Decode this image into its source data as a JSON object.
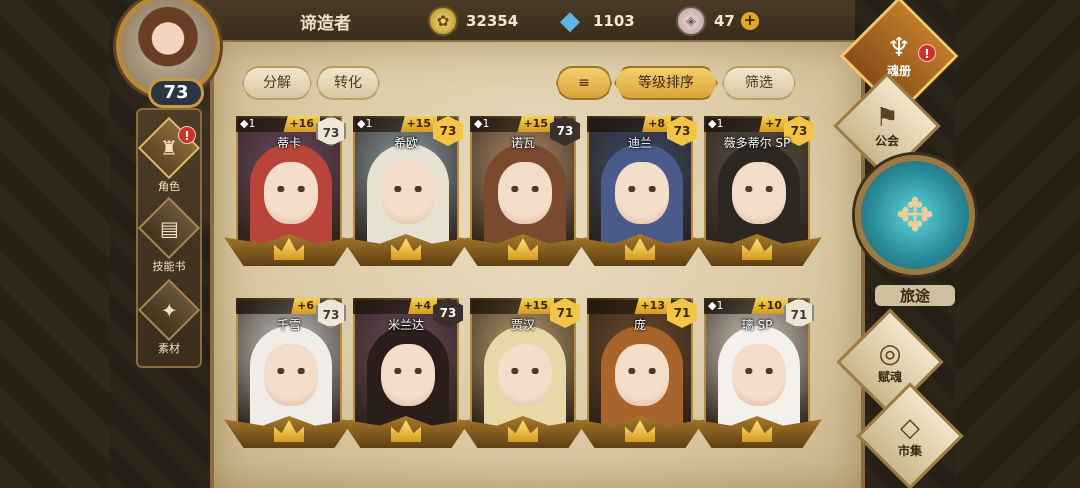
{
  "header": {
    "username": "谛造者",
    "gold": "32354",
    "crystals": "1103",
    "gems": "47",
    "plus_label": "+"
  },
  "player": {
    "level": "73"
  },
  "left_nav": [
    {
      "label": "角色",
      "icon": "helmet-icon",
      "glyph": "♜",
      "active": true,
      "alert": "!"
    },
    {
      "label": "技能书",
      "icon": "skillbook-icon",
      "glyph": "▤",
      "active": false
    },
    {
      "label": "素材",
      "icon": "material-icon",
      "glyph": "✦",
      "active": false
    }
  ],
  "toolbar": {
    "decompose": "分解",
    "convert": "转化",
    "sort_icon": "≡",
    "sort_by_level": "等级排序",
    "filter": "筛选"
  },
  "cards": [
    {
      "name": "蒂卡",
      "star": "◆1",
      "plus": "+16",
      "level": "73",
      "lvl_style": "light",
      "hair": "#b8443a",
      "bg": "#6b4a5e"
    },
    {
      "name": "希欧",
      "star": "◆1",
      "plus": "+15",
      "level": "73",
      "lvl_style": "gold",
      "hair": "#e8e0d0",
      "bg": "#8a9aa0"
    },
    {
      "name": "诺瓦",
      "star": "◆1",
      "plus": "+15",
      "level": "73",
      "lvl_style": "dark",
      "hair": "#7a4a2e",
      "bg": "#b08a6a"
    },
    {
      "name": "迪兰",
      "star": "",
      "plus": "+8",
      "level": "73",
      "lvl_style": "gold",
      "hair": "#4a5a8a",
      "bg": "#3c4a6a"
    },
    {
      "name": "薇多蒂尔 SP",
      "star": "◆1",
      "plus": "+7",
      "level": "73",
      "lvl_style": "gold",
      "hair": "#2e2620",
      "bg": "#5a5046"
    },
    {
      "name": "千雪",
      "star": "",
      "plus": "+6",
      "level": "73",
      "lvl_style": "light",
      "hair": "#f0ece8",
      "bg": "#c8c4c0"
    },
    {
      "name": "米兰达",
      "star": "",
      "plus": "+4",
      "level": "73",
      "lvl_style": "dark",
      "hair": "#2a1e1a",
      "bg": "#6a4a5a"
    },
    {
      "name": "贾汉",
      "star": "",
      "plus": "+15",
      "level": "71",
      "lvl_style": "gold",
      "hair": "#e8d8a8",
      "bg": "#b89a6a"
    },
    {
      "name": "庞",
      "star": "",
      "plus": "+13",
      "level": "71",
      "lvl_style": "gold",
      "hair": "#a8642a",
      "bg": "#6a4a2a"
    },
    {
      "name": "璃 SP",
      "star": "◆1",
      "plus": "+10",
      "level": "71",
      "lvl_style": "light",
      "hair": "#f4f0ec",
      "bg": "#d8ccc0"
    }
  ],
  "right_nav": {
    "soulbook": {
      "label": "魂册",
      "icon": "soulbook-icon",
      "glyph": "♆",
      "alert": "!"
    },
    "guild": {
      "label": "公会",
      "icon": "guild-icon",
      "glyph": "⚑"
    },
    "journey": {
      "label": "旅途",
      "icon": "journey-icon",
      "glyph": "✥"
    },
    "talent": {
      "label": "赋魂",
      "icon": "talent-icon",
      "glyph": "◎"
    },
    "market": {
      "label": "市集",
      "icon": "market-icon",
      "glyph": "◇"
    }
  }
}
